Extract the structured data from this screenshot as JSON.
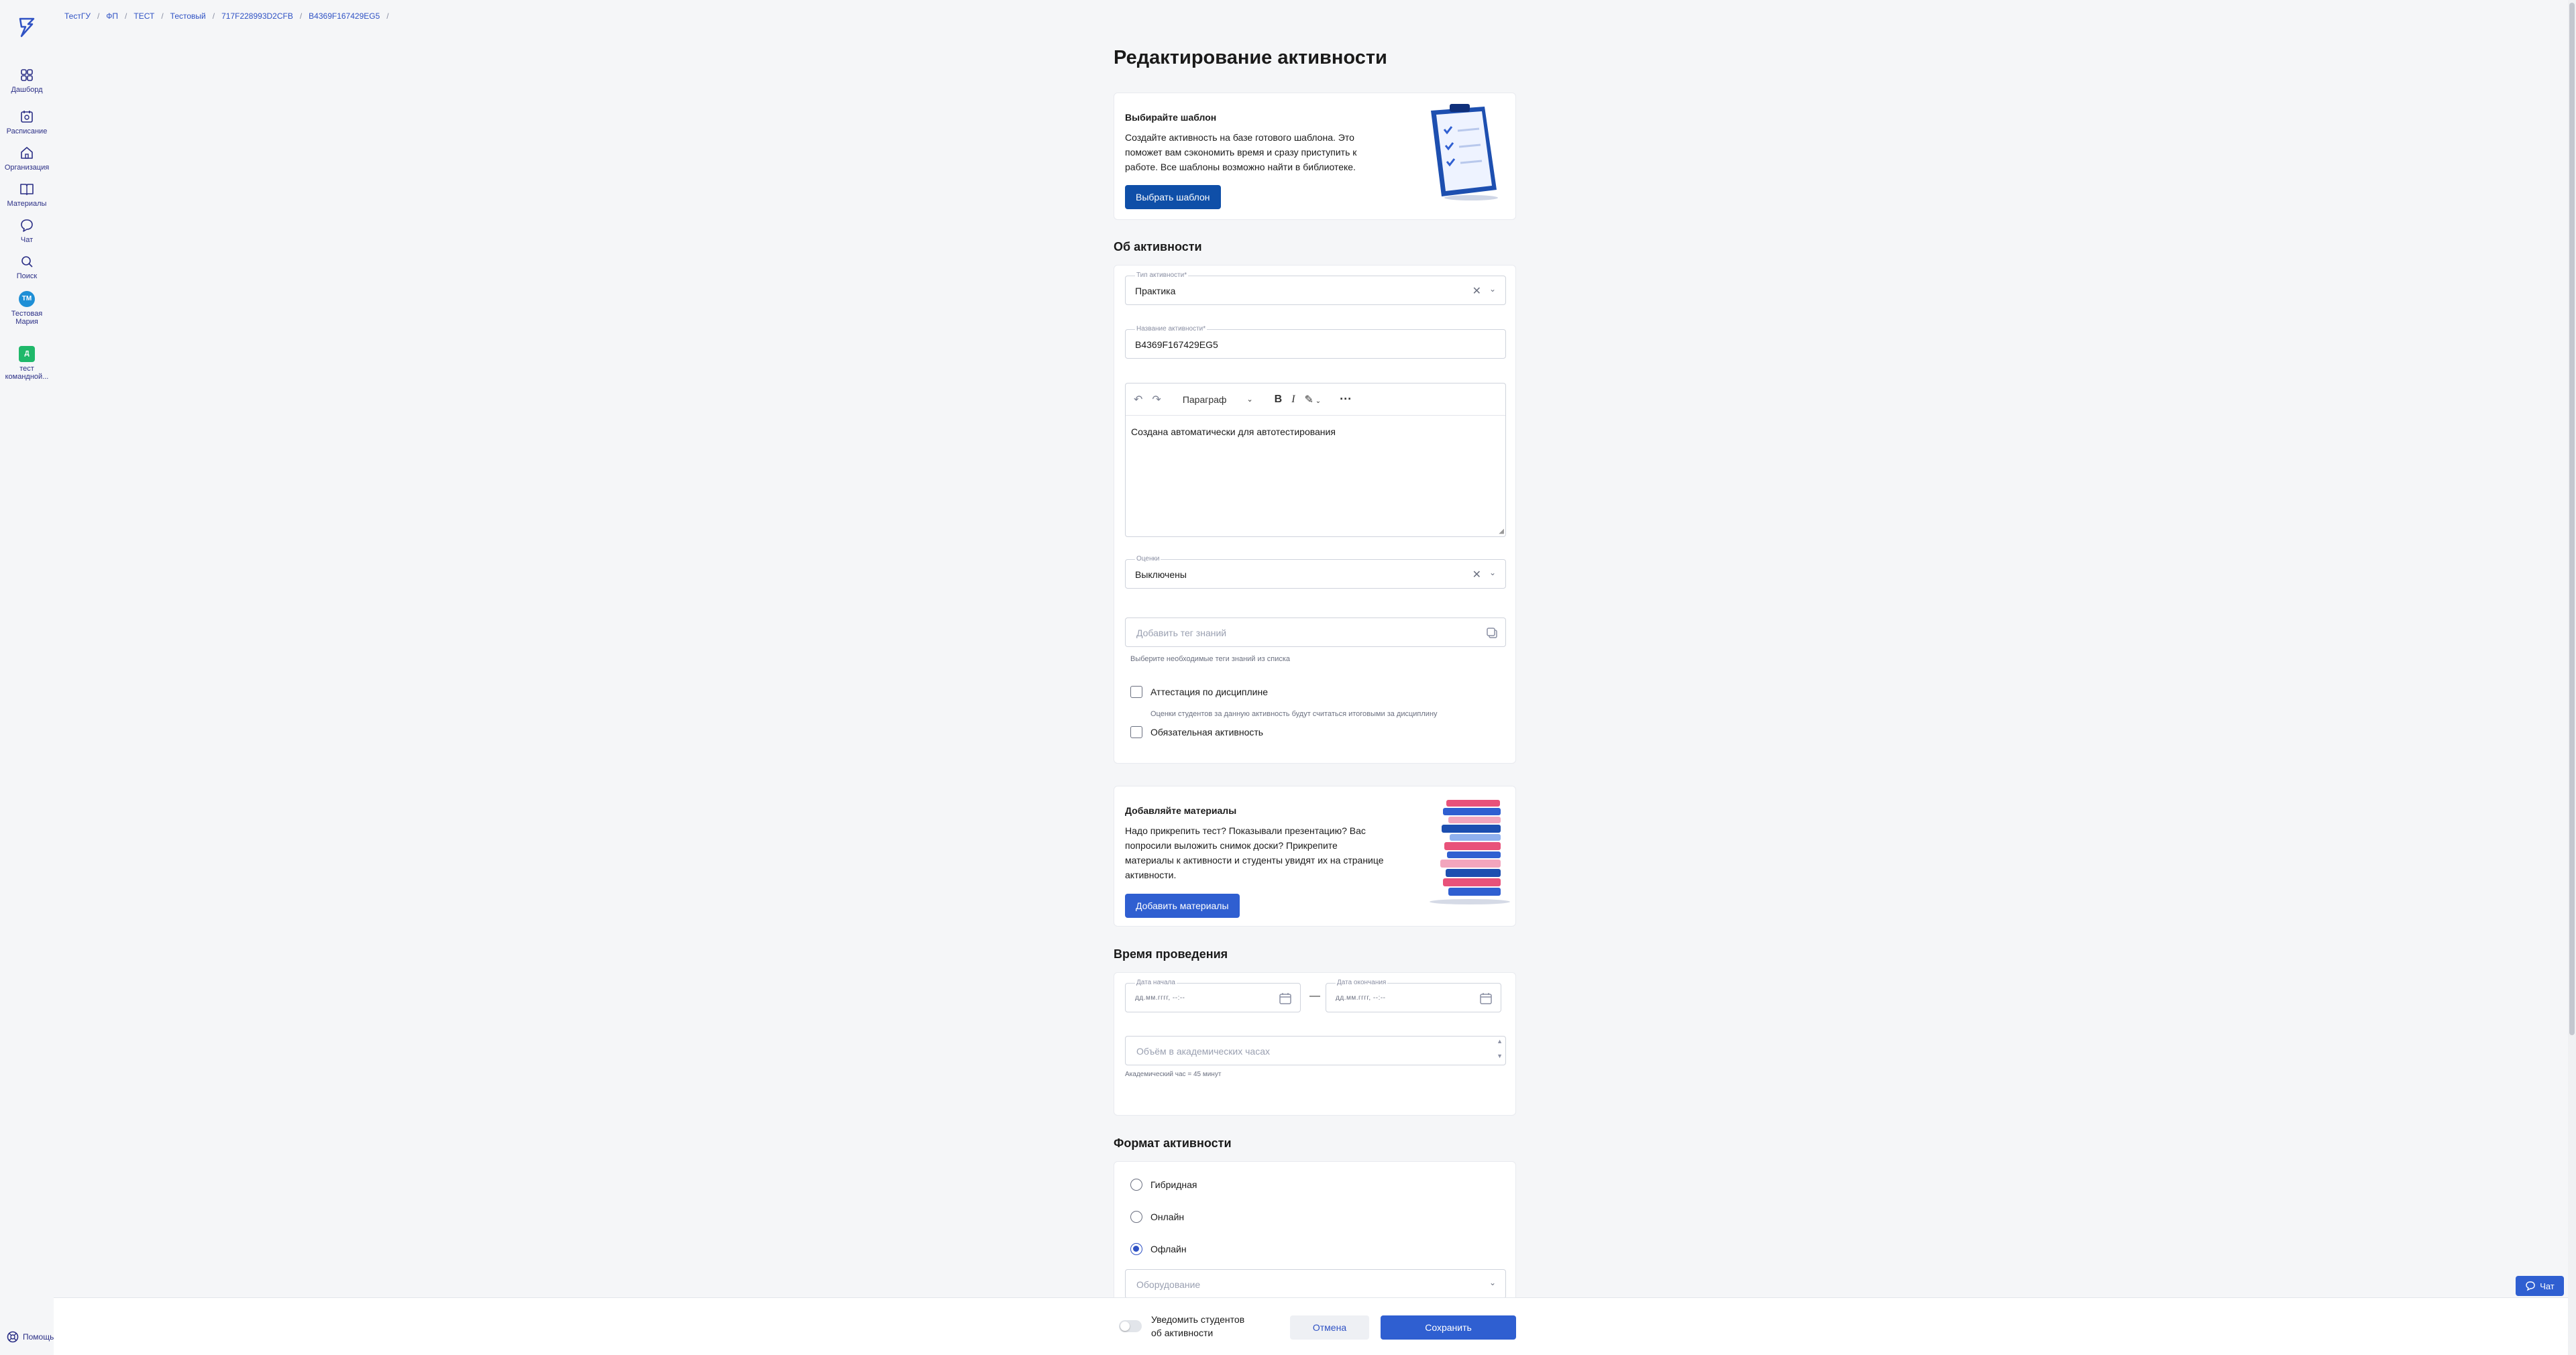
{
  "sidebar": {
    "items": [
      {
        "label": "Дашборд",
        "icon": "dashboard-icon"
      },
      {
        "label": "Расписание",
        "icon": "calendar-icon"
      },
      {
        "label": "Организация",
        "icon": "organization-icon"
      },
      {
        "label": "Материалы",
        "icon": "book-icon"
      },
      {
        "label": "Чат",
        "icon": "chat-icon"
      },
      {
        "label": "Поиск",
        "icon": "search-icon"
      }
    ],
    "user": {
      "initials": "ТМ",
      "label1": "Тестовая",
      "label2": "Мария",
      "color": "#1e8fd6"
    },
    "team": {
      "initials": "Д",
      "label1": "тест",
      "label2": "командной...",
      "color": "#1fb86a"
    },
    "help_label": "Помощь"
  },
  "breadcrumb": [
    "ТестГУ",
    "ФП",
    "ТЕСТ",
    "Тестовый",
    "717F228993D2CFB",
    "B4369F167429EG5"
  ],
  "page": {
    "title": "Редактирование активности"
  },
  "template_card": {
    "title": "Выбирайте шаблон",
    "text": "Создайте активность на базе готового шаблона. Это поможет вам сэкономить время и сразу приступить к работе. Все шаблоны возможно найти в библиотеке.",
    "button": "Выбрать шаблон"
  },
  "about": {
    "title": "Об активности",
    "type_label": "Тип активности*",
    "type_value": "Практика",
    "name_label": "Название активности*",
    "name_value": "B4369F167429EG5",
    "editor": {
      "paragraph": "Параграф",
      "body": "Создана автоматически для автотестирования"
    },
    "grades_label": "Оценки",
    "grades_value": "Выключены",
    "tag_placeholder": "Добавить тег знаний",
    "tag_hint": "Выберите необходимые теги знаний из списка",
    "attestation_label": "Аттестация по дисциплине",
    "attestation_hint": "Оценки студентов за данную активность будут считаться итоговыми за дисциплину",
    "required_label": "Обязательная активность"
  },
  "materials_card": {
    "title": "Добавляйте материалы",
    "text": "Надо прикрепить тест? Показывали презентацию? Вас попросили выложить снимок доски? Прикрепите материалы к активности и студенты увидят их на странице активности.",
    "button": "Добавить материалы"
  },
  "time": {
    "title": "Время проведения",
    "start_label": "Дата начала",
    "end_label": "Дата окончания",
    "date_mask": "дд.мм.гггг, --:--",
    "dash": "—",
    "hours_placeholder": "Объём в академических часах",
    "hours_hint": "Академический час = 45 минут"
  },
  "format": {
    "title": "Формат активности",
    "options": [
      "Гибридная",
      "Онлайн",
      "Офлайн"
    ],
    "selected": "Офлайн",
    "equipment_placeholder": "Оборудование"
  },
  "footer": {
    "notify_line1": "Уведомить студентов",
    "notify_line2": "об активности",
    "cancel": "Отмена",
    "save": "Сохранить"
  },
  "chat_button": "Чат",
  "colors": {
    "primary": "#2f5fd1",
    "dark_primary": "#0f4fa8",
    "link": "#2f52c4",
    "nav_text": "#2b2f86"
  }
}
